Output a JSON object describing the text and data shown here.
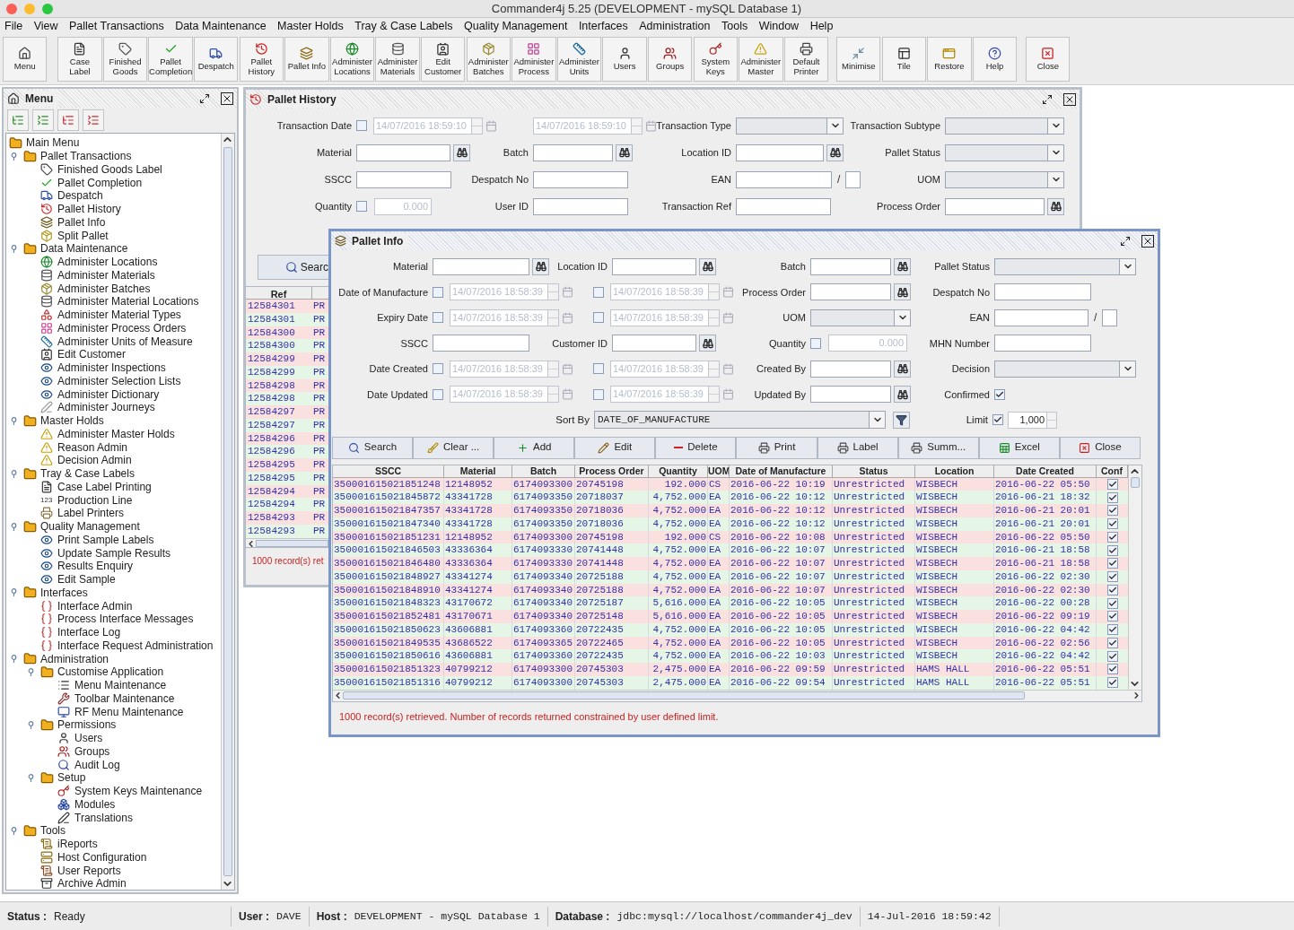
{
  "window": {
    "title": "Commander4j 5.25 (DEVELOPMENT - mySQL Database 1)"
  },
  "menu_bar": [
    "File",
    "View",
    "Pallet Transactions",
    "Data Maintenance",
    "Master Holds",
    "Tray & Case Labels",
    "Quality Management",
    "Interfaces",
    "Administration",
    "Tools",
    "Window",
    "Help"
  ],
  "toolbar": [
    [
      {
        "label": [
          "Menu"
        ]
      }
    ],
    [
      {
        "label": [
          "Case",
          "Label"
        ]
      },
      {
        "label": [
          "Finished",
          "Goods"
        ]
      },
      {
        "label": [
          "Pallet",
          "Completion"
        ]
      },
      {
        "label": [
          "Despatch"
        ]
      },
      {
        "label": [
          "Pallet",
          "History"
        ]
      },
      {
        "label": [
          "Pallet Info"
        ]
      },
      {
        "label": [
          "Administer",
          "Locations"
        ]
      },
      {
        "label": [
          "Administer",
          "Materials"
        ]
      },
      {
        "label": [
          "Edit",
          "Customer"
        ]
      },
      {
        "label": [
          "Administer",
          "Batches"
        ]
      },
      {
        "label": [
          "Administer",
          "Process"
        ]
      },
      {
        "label": [
          "Administer",
          "Units"
        ]
      },
      {
        "label": [
          "Users"
        ]
      },
      {
        "label": [
          "Groups"
        ]
      },
      {
        "label": [
          "System",
          "Keys"
        ]
      },
      {
        "label": [
          "Administer",
          "Master"
        ]
      },
      {
        "label": [
          "Default",
          "Printer"
        ]
      }
    ],
    [
      {
        "label": [
          "Minimise"
        ]
      },
      {
        "label": [
          "Tile"
        ]
      },
      {
        "label": [
          "Restore"
        ]
      },
      {
        "label": [
          "Help"
        ]
      }
    ],
    [
      {
        "label": [
          "Close"
        ]
      }
    ]
  ],
  "menu_panel": {
    "title": "Menu",
    "tree": {
      "label": "Main Menu",
      "children": [
        {
          "label": "Pallet Transactions",
          "expanded": true,
          "children": [
            {
              "label": "Finished Goods Label"
            },
            {
              "label": "Pallet Completion"
            },
            {
              "label": "Despatch"
            },
            {
              "label": "Pallet History"
            },
            {
              "label": "Pallet Info"
            },
            {
              "label": "Split Pallet"
            }
          ]
        },
        {
          "label": "Data Maintenance",
          "expanded": true,
          "children": [
            {
              "label": "Administer Locations"
            },
            {
              "label": "Administer Materials"
            },
            {
              "label": "Administer Batches"
            },
            {
              "label": "Administer Material Locations"
            },
            {
              "label": "Administer Material Types"
            },
            {
              "label": "Administer Process Orders"
            },
            {
              "label": "Administer Units of Measure"
            },
            {
              "label": "Edit Customer"
            },
            {
              "label": "Administer Inspections"
            },
            {
              "label": "Administer Selection Lists"
            },
            {
              "label": "Administer Dictionary"
            },
            {
              "label": "Administer Journeys"
            }
          ]
        },
        {
          "label": "Master Holds",
          "expanded": true,
          "children": [
            {
              "label": "Administer Master Holds"
            },
            {
              "label": "Reason Admin"
            },
            {
              "label": "Decision Admin"
            }
          ]
        },
        {
          "label": "Tray & Case Labels",
          "expanded": true,
          "children": [
            {
              "label": "Case Label Printing"
            },
            {
              "label": "Production Line",
              "icon_text": "123"
            },
            {
              "label": "Label Printers"
            }
          ]
        },
        {
          "label": "Quality Management",
          "expanded": true,
          "children": [
            {
              "label": "Print Sample Labels"
            },
            {
              "label": "Update Sample Results"
            },
            {
              "label": "Results Enquiry"
            },
            {
              "label": "Edit Sample"
            }
          ]
        },
        {
          "label": "Interfaces",
          "expanded": true,
          "children": [
            {
              "label": "Interface Admin"
            },
            {
              "label": "Process Interface Messages"
            },
            {
              "label": "Interface Log"
            },
            {
              "label": "Interface Request Administration"
            }
          ]
        },
        {
          "label": "Administration",
          "expanded": true,
          "children": [
            {
              "label": "Customise Application",
              "expanded": true,
              "children": [
                {
                  "label": "Menu Maintenance"
                },
                {
                  "label": "Toolbar Maintenance"
                },
                {
                  "label": "RF Menu Maintenance"
                }
              ]
            },
            {
              "label": "Permissions",
              "expanded": true,
              "children": [
                {
                  "label": "Users"
                },
                {
                  "label": "Groups"
                },
                {
                  "label": "Audit Log"
                }
              ]
            },
            {
              "label": "Setup",
              "expanded": true,
              "children": [
                {
                  "label": "System Keys Maintenance"
                },
                {
                  "label": "Modules"
                },
                {
                  "label": "Translations"
                }
              ]
            }
          ]
        },
        {
          "label": "Tools",
          "expanded": true,
          "children": [
            {
              "label": "iReports"
            },
            {
              "label": "Host Configuration"
            },
            {
              "label": "User Reports"
            },
            {
              "label": "Archive Admin"
            }
          ]
        }
      ]
    }
  },
  "pallet_history": {
    "title": "Pallet History",
    "fields": [
      {
        "label": "Transaction Date",
        "kind": "date_range",
        "dates": [
          {
            "checked": false,
            "value": "14/07/2016 18:59:10"
          },
          {
            "value": "14/07/2016 18:59:10"
          }
        ]
      },
      {
        "label": "Transaction Type",
        "kind": "combo"
      },
      {
        "label": "Transaction Subtype",
        "kind": "combo"
      },
      {
        "label": "Material",
        "kind": "lookup"
      },
      {
        "label": "Batch",
        "kind": "lookup"
      },
      {
        "label": "Location ID",
        "kind": "lookup"
      },
      {
        "label": "Pallet Status",
        "kind": "combo"
      },
      {
        "label": "SSCC",
        "kind": "text"
      },
      {
        "label": "Despatch No",
        "kind": "text"
      },
      {
        "label": "EAN",
        "kind": "ean",
        "separator": "/"
      },
      {
        "label": "UOM",
        "kind": "combo"
      },
      {
        "label": "Quantity",
        "kind": "quantity",
        "checked": false,
        "value": "0.000"
      },
      {
        "label": "User ID",
        "kind": "text"
      },
      {
        "label": "Transaction Ref",
        "kind": "text"
      },
      {
        "label": "Process Order",
        "kind": "lookup"
      }
    ],
    "search_button": "Searc",
    "table": {
      "columns": [
        "Ref"
      ],
      "rows": [
        {
          "ref": "12584301",
          "column_2": "PR"
        },
        {
          "ref": "12584301",
          "column_2": "PR"
        },
        {
          "ref": "12584300",
          "column_2": "PR"
        },
        {
          "ref": "12584300",
          "column_2": "PR"
        },
        {
          "ref": "12584299",
          "column_2": "PR"
        },
        {
          "ref": "12584299",
          "column_2": "PR"
        },
        {
          "ref": "12584298",
          "column_2": "PR"
        },
        {
          "ref": "12584298",
          "column_2": "PR"
        },
        {
          "ref": "12584297",
          "column_2": "PR"
        },
        {
          "ref": "12584297",
          "column_2": "PR"
        },
        {
          "ref": "12584296",
          "column_2": "PR"
        },
        {
          "ref": "12584296",
          "column_2": "PR"
        },
        {
          "ref": "12584295",
          "column_2": "PR"
        },
        {
          "ref": "12584295",
          "column_2": "PR"
        },
        {
          "ref": "12584294",
          "column_2": "PR"
        },
        {
          "ref": "12584294",
          "column_2": "PR"
        },
        {
          "ref": "12584293",
          "column_2": "PR"
        },
        {
          "ref": "12584293",
          "column_2": "PR"
        }
      ]
    },
    "message": "1000 record(s) ret"
  },
  "pallet_info": {
    "title": "Pallet Info",
    "fields": [
      {
        "label": "Material",
        "kind": "lookup"
      },
      {
        "label": "Location ID",
        "kind": "lookup"
      },
      {
        "label": "Batch",
        "kind": "lookup"
      },
      {
        "label": "Pallet Status",
        "kind": "combo"
      },
      {
        "label": "Date of Manufacture",
        "kind": "date_range",
        "dates": [
          {
            "checked": false,
            "value": "14/07/2016 18:58:39"
          },
          {
            "checked": false,
            "value": "14/07/2016 18:58:39"
          }
        ]
      },
      {
        "label": "Process Order",
        "kind": "lookup"
      },
      {
        "label": "Despatch No",
        "kind": "text"
      },
      {
        "label": "Expiry Date",
        "kind": "date_range",
        "dates": [
          {
            "checked": false,
            "value": "14/07/2016 18:58:39"
          },
          {
            "checked": false,
            "value": "14/07/2016 18:58:39"
          }
        ]
      },
      {
        "label": "UOM",
        "kind": "combo"
      },
      {
        "label": "EAN",
        "kind": "ean",
        "separator": "/"
      },
      {
        "label": "SSCC",
        "kind": "text"
      },
      {
        "label": "Customer ID",
        "kind": "lookup"
      },
      {
        "label": "Quantity",
        "kind": "quantity",
        "checked": false,
        "value": "0.000"
      },
      {
        "label": "MHN Number",
        "kind": "text"
      },
      {
        "label": "Date Created",
        "kind": "date_range",
        "dates": [
          {
            "checked": false,
            "value": "14/07/2016 18:58:39"
          },
          {
            "checked": false,
            "value": "14/07/2016 18:58:39"
          }
        ]
      },
      {
        "label": "Created By",
        "kind": "lookup"
      },
      {
        "label": "Decision",
        "kind": "combo"
      },
      {
        "label": "Date Updated",
        "kind": "date_range",
        "dates": [
          {
            "checked": false,
            "value": "14/07/2016 18:58:39"
          },
          {
            "checked": false,
            "value": "14/07/2016 18:58:39"
          }
        ]
      },
      {
        "label": "Updated By",
        "kind": "lookup"
      },
      {
        "label": "Confirmed",
        "kind": "checkbox",
        "checked": true
      }
    ],
    "sort": {
      "label": "Sort By",
      "value": "DATE_OF_MANUFACTURE"
    },
    "limit": {
      "label": "Limit",
      "checked": true,
      "value": "1,000"
    },
    "buttons": [
      "Search",
      "Clear ...",
      "Add",
      "Edit",
      "Delete",
      "Print",
      "Label",
      "Summ...",
      "Excel",
      "Close"
    ],
    "table": {
      "columns": [
        "SSCC",
        "Material",
        "Batch",
        "Process Order",
        "Quantity",
        "UOM",
        "Date of Manufacture",
        "Status",
        "Location",
        "Date Created",
        "Conf"
      ],
      "rows": [
        {
          "cells": [
            "350001615021851248",
            "12148952",
            "6174093300",
            "20745198",
            "192.000",
            "CS",
            "2016-06-22 10:19",
            "Unrestricted",
            "WISBECH",
            "2016-06-22 05:50"
          ],
          "conf": true
        },
        {
          "cells": [
            "350001615021845872",
            "43341728",
            "6174093350",
            "20718037",
            "4,752.000",
            "EA",
            "2016-06-22 10:12",
            "Unrestricted",
            "WISBECH",
            "2016-06-21 18:32"
          ],
          "conf": true
        },
        {
          "cells": [
            "350001615021847357",
            "43341728",
            "6174093350",
            "20718036",
            "4,752.000",
            "EA",
            "2016-06-22 10:12",
            "Unrestricted",
            "WISBECH",
            "2016-06-21 20:01"
          ],
          "conf": true
        },
        {
          "cells": [
            "350001615021847340",
            "43341728",
            "6174093350",
            "20718036",
            "4,752.000",
            "EA",
            "2016-06-22 10:12",
            "Unrestricted",
            "WISBECH",
            "2016-06-21 20:01"
          ],
          "conf": true
        },
        {
          "cells": [
            "350001615021851231",
            "12148952",
            "6174093300",
            "20745198",
            "192.000",
            "CS",
            "2016-06-22 10:08",
            "Unrestricted",
            "WISBECH",
            "2016-06-22 05:50"
          ],
          "conf": true
        },
        {
          "cells": [
            "350001615021846503",
            "43336364",
            "6174093330",
            "20741448",
            "4,752.000",
            "EA",
            "2016-06-22 10:07",
            "Unrestricted",
            "WISBECH",
            "2016-06-21 18:58"
          ],
          "conf": true
        },
        {
          "cells": [
            "350001615021846480",
            "43336364",
            "6174093330",
            "20741448",
            "4,752.000",
            "EA",
            "2016-06-22 10:07",
            "Unrestricted",
            "WISBECH",
            "2016-06-21 18:58"
          ],
          "conf": true
        },
        {
          "cells": [
            "350001615021848927",
            "43341274",
            "6174093340",
            "20725188",
            "4,752.000",
            "EA",
            "2016-06-22 10:07",
            "Unrestricted",
            "WISBECH",
            "2016-06-22 02:30"
          ],
          "conf": true
        },
        {
          "cells": [
            "350001615021848910",
            "43341274",
            "6174093340",
            "20725188",
            "4,752.000",
            "EA",
            "2016-06-22 10:07",
            "Unrestricted",
            "WISBECH",
            "2016-06-22 02:30"
          ],
          "conf": true
        },
        {
          "cells": [
            "350001615021848323",
            "43170672",
            "6174093340",
            "20725187",
            "5,616.000",
            "EA",
            "2016-06-22 10:05",
            "Unrestricted",
            "WISBECH",
            "2016-06-22 00:28"
          ],
          "conf": true
        },
        {
          "cells": [
            "350001615021852481",
            "43170671",
            "6174093340",
            "20725148",
            "5,616.000",
            "EA",
            "2016-06-22 10:05",
            "Unrestricted",
            "WISBECH",
            "2016-06-22 09:19"
          ],
          "conf": true
        },
        {
          "cells": [
            "350001615021850623",
            "43606881",
            "6174093360",
            "20722435",
            "4,752.000",
            "EA",
            "2016-06-22 10:05",
            "Unrestricted",
            "WISBECH",
            "2016-06-22 04:42"
          ],
          "conf": true
        },
        {
          "cells": [
            "350001615021849535",
            "43686522",
            "6174093365",
            "20722465",
            "4,752.000",
            "EA",
            "2016-06-22 10:05",
            "Unrestricted",
            "WISBECH",
            "2016-06-22 02:56"
          ],
          "conf": true
        },
        {
          "cells": [
            "350001615021850616",
            "43606881",
            "6174093360",
            "20722435",
            "4,752.000",
            "EA",
            "2016-06-22 10:03",
            "Unrestricted",
            "WISBECH",
            "2016-06-22 04:42"
          ],
          "conf": true
        },
        {
          "cells": [
            "350001615021851323",
            "40799212",
            "6174093300",
            "20745303",
            "2,475.000",
            "EA",
            "2016-06-22 09:59",
            "Unrestricted",
            "HAMS HALL",
            "2016-06-22 05:51"
          ],
          "conf": true
        },
        {
          "cells": [
            "350001615021851316",
            "40799212",
            "6174093300",
            "20745303",
            "2,475.000",
            "EA",
            "2016-06-22 09:54",
            "Unrestricted",
            "HAMS HALL",
            "2016-06-22 05:51"
          ],
          "conf": true
        }
      ]
    },
    "message": "1000 record(s) retrieved. Number of records returned constrained by user defined limit."
  },
  "status_bar": {
    "items": [
      {
        "label": "Status :",
        "value": "Ready"
      },
      {
        "label": "User :",
        "value": "DAVE"
      },
      {
        "label": "Host :",
        "value": "DEVELOPMENT - mySQL Database 1"
      },
      {
        "label": "Database :",
        "value": "jdbc:mysql://localhost/commander4j_dev"
      }
    ],
    "datetime": "14-Jul-2016 18:59:42"
  }
}
